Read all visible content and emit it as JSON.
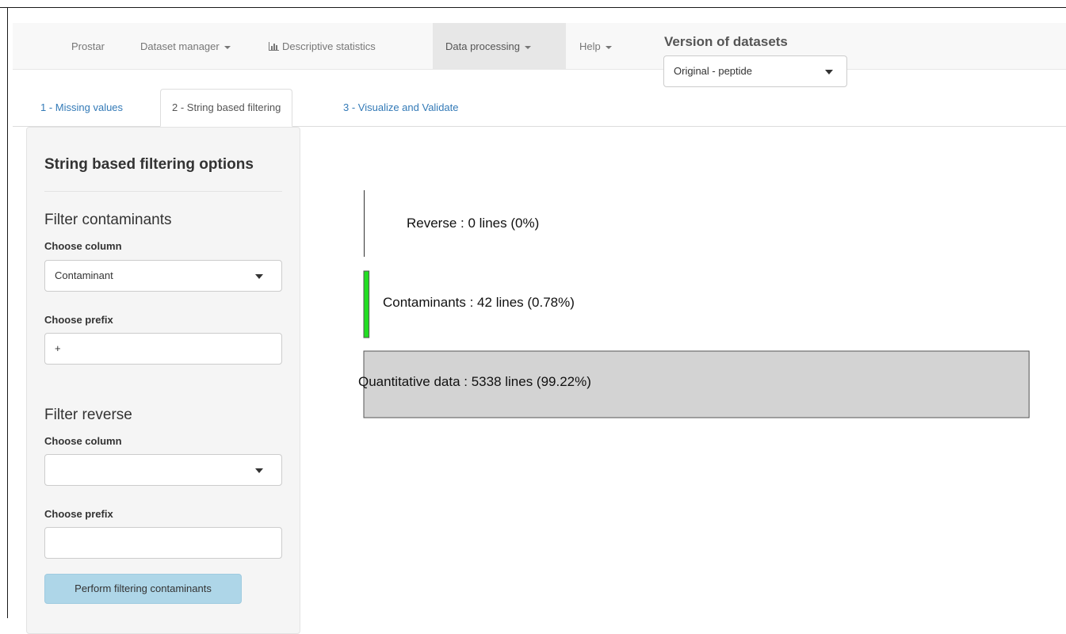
{
  "navbar": {
    "brand": "Prostar",
    "items": [
      {
        "label": "Dataset manager",
        "dropdown": true
      },
      {
        "label": "Descriptive statistics",
        "icon": "bar-chart-icon"
      },
      {
        "label": "Data processing",
        "dropdown": true,
        "active": true
      },
      {
        "label": "Help",
        "dropdown": true
      }
    ]
  },
  "version": {
    "title": "Version of datasets",
    "selected": "Original - peptide"
  },
  "tabs": [
    {
      "label": "1 - Missing values"
    },
    {
      "label": "2 - String based filtering",
      "active": true
    },
    {
      "label": "3 - Visualize and Validate"
    }
  ],
  "sidebar": {
    "title": "String based filtering options",
    "contaminants": {
      "title": "Filter contaminants",
      "column_label": "Choose column",
      "column_value": "Contaminant",
      "prefix_label": "Choose prefix",
      "prefix_value": "+"
    },
    "reverse": {
      "title": "Filter reverse",
      "column_label": "Choose column",
      "column_value": "",
      "prefix_label": "Choose prefix",
      "prefix_value": ""
    },
    "button_label": "Perform filtering contaminants"
  },
  "chart_data": {
    "type": "bar",
    "orientation": "horizontal",
    "categories": [
      "Reverse",
      "Contaminants",
      "Quantitative data"
    ],
    "values": [
      0,
      42,
      5338
    ],
    "percentages": [
      0,
      0.78,
      99.22
    ],
    "labels": [
      "Reverse : 0 lines (0%)",
      "Contaminants : 42 lines (0.78%)",
      "Quantitative data : 5338 lines (99.22%)"
    ],
    "colors": [
      "#333333",
      "#22dd22",
      "#d3d3d3"
    ]
  }
}
